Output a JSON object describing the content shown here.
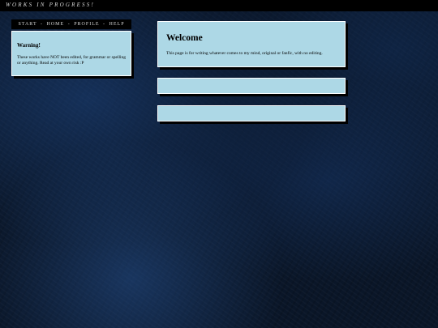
{
  "site": {
    "title": "WORKS IN PROGRESS!"
  },
  "nav": {
    "items": [
      {
        "label": "START"
      },
      {
        "label": "HOME"
      },
      {
        "label": "PROFILE"
      },
      {
        "label": "HELP"
      }
    ],
    "separator": "-"
  },
  "warning": {
    "title": "Warning!",
    "text": "These works have NOT been edited, for grammar or spelling or anything. Read at your own risk :P"
  },
  "welcome": {
    "title": "Welcome",
    "text": "This page is for writing whatever comes to my mind, original or fanfic, with no editing."
  },
  "colors": {
    "panel_bg": "#add8e6",
    "topbar_bg": "#000000",
    "page_bg": "#0a1628"
  }
}
